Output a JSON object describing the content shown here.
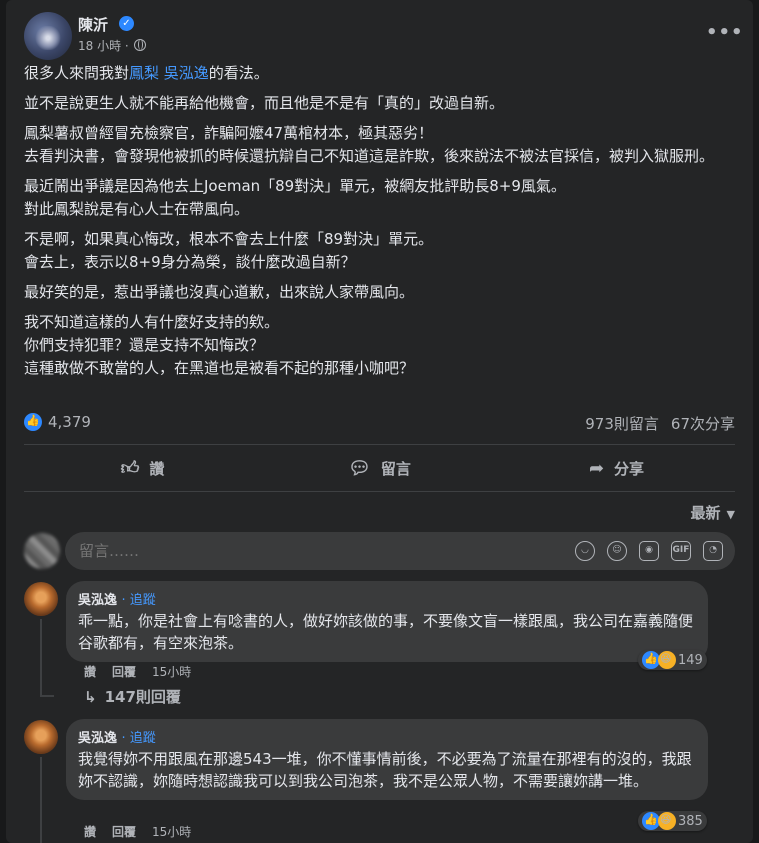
{
  "post": {
    "author": "陳沂",
    "time": "18 小時 ·",
    "more": "•••",
    "paragraphs": [
      {
        "pre": "很多人來問我對",
        "link": "鳳梨 吳泓逸",
        "post": "的看法。"
      },
      {
        "text": "並不是說更生人就不能再給他機會，而且他是不是有「真的」改過自新。"
      },
      {
        "text": "鳳梨薯叔曾經冒充檢察官，詐騙阿嬤47萬棺材本，極其惡劣！\n去看判決書，會發現他被抓的時候還抗辯自己不知道這是詐欺，後來說法不被法官採信，被判入獄服刑。"
      },
      {
        "text": "最近鬧出爭議是因為他去上Joeman「89對決」單元，被網友批評助長8+9風氣。\n對此鳳梨說是有心人士在帶風向。"
      },
      {
        "text": "不是啊，如果真心悔改，根本不會去上什麼「89對決」單元。\n會去上，表示以8+9身分為榮，談什麼改過自新？"
      },
      {
        "text": "最好笑的是，惹出爭議也沒真心道歉，出來說人家帶風向。"
      },
      {
        "text": "我不知道這樣的人有什麼好支持的欸。\n你們支持犯罪？還是支持不知悔改？\n這種敢做不敢當的人，在黑道也是被看不起的那種小咖吧？"
      }
    ],
    "reactions_count": "4,379",
    "comments_count": "973則留言",
    "shares_count": "67次分享"
  },
  "actions": {
    "like": "讚",
    "comment": "留言",
    "share": "分享"
  },
  "sort_label": "最新",
  "comment_input": {
    "placeholder": "留言……",
    "icons": [
      "sticker-icon",
      "emoji-icon",
      "camera-icon",
      "gif-icon",
      "sticker2-icon"
    ],
    "gif": "GIF"
  },
  "comments": [
    {
      "name": "吳泓逸",
      "follow": "· 追蹤",
      "text": "乖一點，你是社會上有唸書的人，做好妳該做的事，不要像文盲一樣跟風，我公司在嘉義隨便谷歌都有，有空來泡茶。",
      "like": "讚",
      "reply": "回覆",
      "time": "15小時",
      "reactions": "149",
      "replies": "147則回覆"
    },
    {
      "name": "吳泓逸",
      "follow": "· 追蹤",
      "text": "我覺得妳不用跟風在那邊543一堆，你不懂事情前後，不必要為了流量在那裡有的沒的，我跟妳不認識，妳隨時想認識我可以到我公司泡茶，我不是公眾人物，不需要讓妳講一堆。",
      "like": "讚",
      "reply": "回覆",
      "time": "15小時",
      "reactions": "385"
    }
  ]
}
